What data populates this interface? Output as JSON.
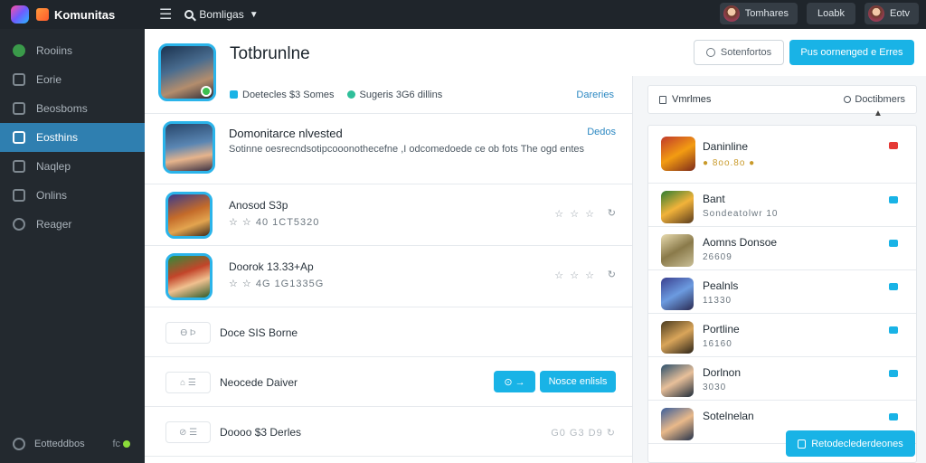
{
  "app": {
    "name": "Komunitas"
  },
  "topbar": {
    "search_label": "Bomligas",
    "user_pill": "Tomhares",
    "action_pill": "Loabk",
    "profile_pill": "Eotv"
  },
  "sidebar": {
    "items": [
      {
        "label": "Rooiins",
        "icon": "home-icon",
        "active": false
      },
      {
        "label": "Eorie",
        "icon": "pen-icon",
        "active": false
      },
      {
        "label": "Beosboms",
        "icon": "puzzle-icon",
        "active": false
      },
      {
        "label": "Eosthins",
        "icon": "folder-icon",
        "active": true
      },
      {
        "label": "Naqlep",
        "icon": "chart-icon",
        "active": false
      },
      {
        "label": "Onlins",
        "icon": "list-icon",
        "active": false
      },
      {
        "label": "Reager",
        "icon": "user-icon",
        "active": false
      }
    ],
    "footer": {
      "label": "Eotteddbos",
      "badge": "fc"
    }
  },
  "header": {
    "title": "Totbrunlne",
    "outline_button": "Sotenfortos",
    "primary_button": "Pus oornenged e Erres"
  },
  "stats": {
    "item1": "Doetecles $3 Somes",
    "item2": "Sugeris 3G6 dillins",
    "link": "Dareries"
  },
  "feature": {
    "title": "Domonitarce nlvested",
    "link": "Dedos",
    "description": "Sotinne oesrecndsotipcooonothecefne ,I odcomedoede ce ob fots The ogd entes"
  },
  "games": [
    {
      "title": "Anosod S3p",
      "sub": "☆ ☆ 40 1CT5320",
      "rating": "☆ ☆ ☆",
      "arrow": "↻"
    },
    {
      "title": "Doorok 13.33+Ap",
      "sub": "☆ ☆ 4G 1G1335G",
      "rating": "☆ ☆ ☆",
      "arrow": "↻"
    }
  ],
  "links": [
    {
      "chip": "Ɵ Ϸ",
      "label": "Doce SIS Borne",
      "meta": ""
    },
    {
      "chip": "⌂ ☰",
      "label": "Neocede Daiver",
      "button_a": "⊙ →",
      "button_b": "Nosce enlisls",
      "meta": ""
    },
    {
      "chip": "⊘ ☰",
      "label": "Doooo $3 Derles",
      "meta": "G0 G3 D9 ↻"
    }
  ],
  "right_panel": {
    "head_left": "Vmrlmes",
    "head_right": "Doctibmers",
    "items": [
      {
        "title": "Daninline",
        "sub": "● 8oo.8o ●",
        "flag": "red"
      },
      {
        "title": "Bant",
        "sub": "Sondeatolwr 10",
        "flag": "blue"
      },
      {
        "title": "Aomns Donsoe",
        "sub": "26609",
        "flag": "blue"
      },
      {
        "title": "Pealnls",
        "sub": "11330",
        "flag": "blue"
      },
      {
        "title": "Portline",
        "sub": "16160",
        "flag": "blue"
      },
      {
        "title": "Dorlnon",
        "sub": "3030",
        "flag": "blue"
      },
      {
        "title": "Sotelnelan",
        "sub": "",
        "flag": "blue"
      }
    ],
    "bottom_button": "Retodeclederdeones"
  },
  "colors": {
    "accent": "#19b3e6",
    "sidebar_bg": "#23292f",
    "topbar_bg": "#1f252b",
    "active_item": "#2f7fb0"
  }
}
